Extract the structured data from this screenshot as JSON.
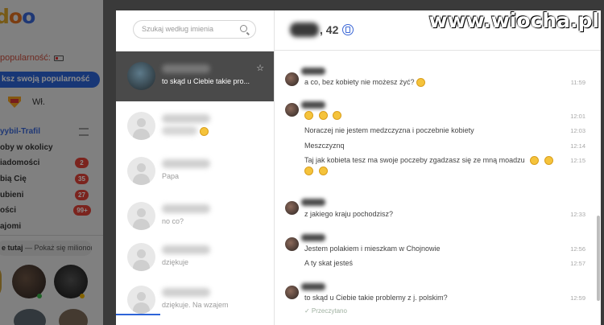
{
  "app": {
    "logo": "badoo",
    "popularity_label": "popularność:",
    "boost_button": "ksz swoją popularność",
    "super_label": "Wł.",
    "menu": [
      {
        "label": "yybil-Trafil",
        "active": true,
        "badge": null,
        "filter": true
      },
      {
        "label": "oby w okolicy",
        "active": false,
        "badge": null
      },
      {
        "label": "iadomości",
        "active": false,
        "badge": "2"
      },
      {
        "label": "bią Cię",
        "active": false,
        "badge": "35"
      },
      {
        "label": "ubieni",
        "active": false,
        "badge": "27"
      },
      {
        "label": "ości",
        "active": false,
        "badge": "99+"
      },
      {
        "label": "ajomi",
        "active": false,
        "badge": null
      }
    ],
    "promo_bold": "e tutaj",
    "promo_rest": " — Pokaż się milionom!"
  },
  "conversations": {
    "search_placeholder": "Szukaj według imienia",
    "items": [
      {
        "preview": "to skąd u Ciebie takie pro...",
        "selected": true
      },
      {
        "preview": "",
        "emoji": true,
        "selected": false
      },
      {
        "preview": "Papa",
        "selected": false
      },
      {
        "preview": "no co?",
        "selected": false
      },
      {
        "preview": "dziękuje",
        "selected": false
      },
      {
        "preview": "dziękuje. Na wzajem",
        "selected": false
      }
    ]
  },
  "chat": {
    "header_age": ", 42",
    "messages": [
      {
        "text": "a co, bez kobiety nie możesz żyć?",
        "emojis": 1,
        "time": "11:59"
      },
      {
        "text": "",
        "emojis": 3,
        "time": "12:01"
      },
      {
        "text": "Noraczej nie jestem medzczyzna i poczebnie kobiety",
        "emojis": 0,
        "time": "12:03"
      },
      {
        "text": "Meszczyznq",
        "emojis": 0,
        "time": "12:14"
      },
      {
        "text": "Taj jak kobieta tesz ma swoje poczeby zgadzasz się ze mną moadzu",
        "emojis": 2,
        "time": "12:15"
      },
      {
        "text": "z jakiego kraju pochodzisz?",
        "emojis": 0,
        "time": "12:33"
      },
      {
        "text": "Jestem polakiem i mieszkam w Chojnowie",
        "emojis": 0,
        "time": "12:56"
      },
      {
        "text": "A ty skat jesteś",
        "emojis": 0,
        "time": "12:57"
      },
      {
        "text": "to skąd u Ciebie takie problemy z j. polskim?",
        "emojis": 0,
        "time": "12:59"
      }
    ],
    "read_receipt": "✓ Przeczytano"
  },
  "watermark": "www.wiocha.pl",
  "colors": {
    "accent": "#2d64d8",
    "badge": "#e14238",
    "selected_row": "#4a4a4a"
  }
}
